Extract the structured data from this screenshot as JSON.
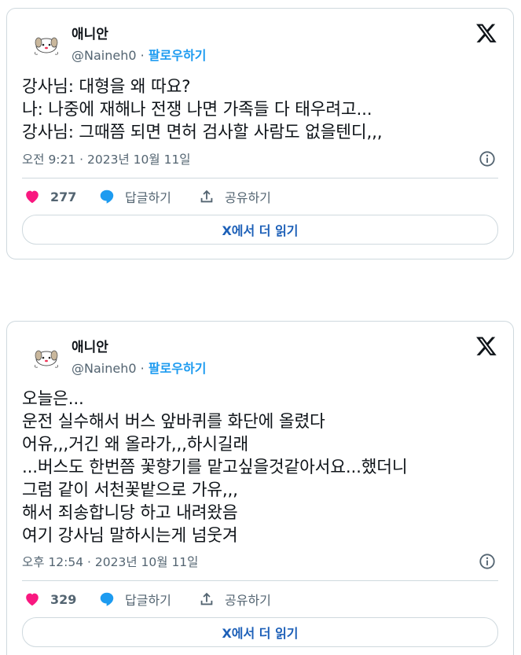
{
  "tweets": [
    {
      "author": "애니안",
      "handle": "@Naineh0",
      "separator": "·",
      "follow_label": "팔로우하기",
      "text": "강사님: 대형을 왜 따요?\n나: 나중에 재해나 전쟁 나면 가족들 다 태우려고...\n강사님: 그때쯤 되면 면허 검사할 사람도 없을텐디,,,",
      "timestamp": "오전 9:21 · 2023년 10월 11일",
      "likes": "277",
      "reply_label": "답글하기",
      "share_label": "공유하기",
      "read_more": "X에서 더 읽기"
    },
    {
      "author": "애니안",
      "handle": "@Naineh0",
      "separator": "·",
      "follow_label": "팔로우하기",
      "text": "오늘은...\n운전 실수해서 버스 앞바퀴를 화단에 올렸다\n어유,,,거긴 왜 올라가,,,하시길래\n...버스도 한번쯤 꽃향기를 맡고싶을것같아서요...했더니\n그럼 같이 서천꽃밭으로 가유,,,\n해서 죄송합니당 하고 내려왔음\n여기 강사님 말하시는게 넘웃겨",
      "timestamp": "오후 12:54 · 2023년 10월 11일",
      "likes": "329",
      "reply_label": "답글하기",
      "share_label": "공유하기",
      "read_more": "X에서 더 읽기"
    }
  ],
  "colors": {
    "like": "#f91880",
    "reply": "#1d9bf0",
    "follow": "#1d9bf0",
    "read_more": "#1d60b8",
    "border": "#cfd9de",
    "muted": "#536471"
  },
  "icons": [
    "x-logo-icon",
    "info-icon",
    "heart-icon",
    "reply-bubble-icon",
    "share-icon",
    "avatar-dog-icon"
  ]
}
